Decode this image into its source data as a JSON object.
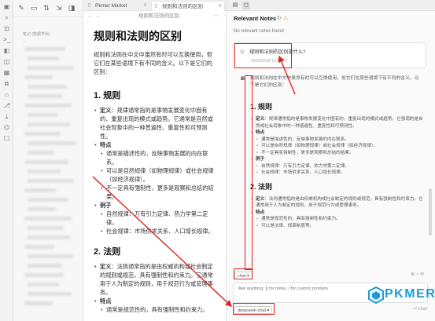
{
  "ribbon": {
    "icons": [
      "folder-icon",
      "search-icon",
      "bookmark-icon",
      "graph-icon",
      "terminal-icon",
      "files-icon",
      "calendar-icon",
      "template-icon",
      "tag-icon",
      "git-icon",
      "download-icon",
      "publish-icon",
      "chat-icon"
    ]
  },
  "explorer": {
    "tree_labels": [
      "笔记 (数据学科)",
      "..."
    ]
  },
  "editor": {
    "tabs": [
      {
        "label": "Pkmer Market"
      },
      {
        "label": "规则和法则的区别"
      }
    ],
    "doc_title_bar": "规则和法则的区别",
    "title": "规则和法则的区别",
    "intro": "规则和法则在中文中虽然有时可以互换使用，但它们在某些语境下有不同的含义。以下是它们的区别：",
    "section1": {
      "heading": "1. 规则",
      "items": [
        {
          "bold": "定义",
          "text": "：规律通常指的是事物发展变化中固有的、重复出现的模式或趋势。它通常是自然或社会现象中的一种普遍性、重复性和可预测性。"
        },
        {
          "bold": "特点",
          "text": ""
        }
      ],
      "subitems": [
        "通常是描述性的，反映事物发展的内在联系。",
        "可以是自然规律（如物理规律）或社会规律（如经济规律）。",
        "不一定具有强制性，更多是观察和总结的结果。"
      ],
      "example_label": "例子",
      "examples": [
        "自然规律：万有引力定律、热力学第二定律。",
        "社会规律：市场供求关系、人口增长规律。"
      ]
    },
    "section2": {
      "heading": "2. 法则",
      "items": [
        {
          "bold": "定义",
          "text": "：法则通常指的是由权威机构或社会制定的规则或规范，具有强制性和约束力。它通常用于人为制定的规则，用于规范行为或管理事务。"
        },
        {
          "bold": "特点",
          "text": ""
        }
      ],
      "subitems": [
        "通常是规范性的，具有强制性和约束力。"
      ]
    }
  },
  "right_panel": {
    "title": "Relevant Notes",
    "status": "No relevant notes found",
    "user_question": "规则和法则的区别是什么?",
    "question_time": "2025/02/08 15:07:17",
    "answer": {
      "intro": "规则和法则在中文中虽然有时可以互换使用，但它们在某些语境下有不同的含义。以下是它们的区别：",
      "s1_heading": "1. 规则",
      "s1_def_label": "定义",
      "s1_def": "：规律通常指的是事物发展变化中固有的、重复出现的模式或趋势。它强调的是自然或社会现象中的一种普遍性、重复性和可预测性。",
      "s1_feat_label": "特点",
      "s1_feats": [
        "通常是描述性的，反映事物发展的内在联系。",
        "可以是自然规律（如物理规律）或社会规律（如经济规律）。",
        "不一定具有强制性，更多是观察和总结的结果。"
      ],
      "s1_ex_label": "例子",
      "s1_examples": [
        "自然规律：万有引力定律、热力学第二定律。",
        "社会规律：市场供求关系、人口增长规律。"
      ],
      "s2_heading": "2. 法则",
      "s2_def_label": "定义",
      "s2_def": "：法则通常指的是由权威机构或社会制定的规则或规范，具有强制性和约束力。它通常用于人为制定的规则，用于规范行为或管理事务。",
      "s2_feat_label": "特点",
      "s2_feats": [
        "通常是规范性的，具有强制性和约束力。",
        "可以是法律、规章制度等。"
      ]
    },
    "chat_mode": "chat",
    "chat_mode_arrow": "▾",
    "input_placeholder": "Ask anything. [[ for notes, / for custom prompts",
    "model": "deepseek-chat",
    "model_arrow": "▾",
    "send_label": "⏎ chat"
  },
  "watermark": {
    "text": "PKMER"
  },
  "colors": {
    "accent": "#1b9bd7",
    "annotation": "#e02020"
  }
}
